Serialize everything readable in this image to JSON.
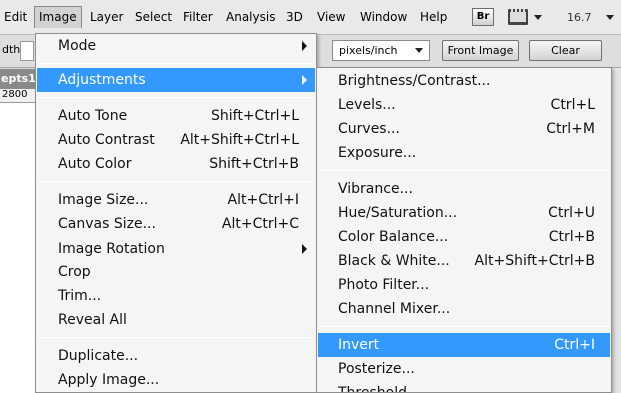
{
  "menubar": {
    "items": [
      "Edit",
      "Image",
      "Layer",
      "Select",
      "Filter",
      "Analysis",
      "3D",
      "View",
      "Window",
      "Help"
    ],
    "active": "Image",
    "bridge_label": "Br",
    "zoom": "16.7"
  },
  "options": {
    "width_label": "dth:",
    "units": "pixels/inch",
    "front_image": "Front Image",
    "clear": "Clear"
  },
  "document": {
    "tab": "epts1-",
    "ruler_value": "2800"
  },
  "image_menu": {
    "mode": "Mode",
    "adjustments": "Adjustments",
    "auto_tone": "Auto Tone",
    "auto_tone_sc": "Shift+Ctrl+L",
    "auto_contrast": "Auto Contrast",
    "auto_contrast_sc": "Alt+Shift+Ctrl+L",
    "auto_color": "Auto Color",
    "auto_color_sc": "Shift+Ctrl+B",
    "image_size": "Image Size...",
    "image_size_sc": "Alt+Ctrl+I",
    "canvas_size": "Canvas Size...",
    "canvas_size_sc": "Alt+Ctrl+C",
    "image_rotation": "Image Rotation",
    "crop": "Crop",
    "trim": "Trim...",
    "reveal_all": "Reveal All",
    "duplicate": "Duplicate...",
    "apply_image": "Apply Image..."
  },
  "adjustments_menu": {
    "brightness": "Brightness/Contrast...",
    "levels": "Levels...",
    "levels_sc": "Ctrl+L",
    "curves": "Curves...",
    "curves_sc": "Ctrl+M",
    "exposure": "Exposure...",
    "vibrance": "Vibrance...",
    "hue_sat": "Hue/Saturation...",
    "hue_sat_sc": "Ctrl+U",
    "color_balance": "Color Balance...",
    "color_balance_sc": "Ctrl+B",
    "black_white": "Black & White...",
    "black_white_sc": "Alt+Shift+Ctrl+B",
    "photo_filter": "Photo Filter...",
    "channel_mixer": "Channel Mixer...",
    "invert": "Invert",
    "invert_sc": "Ctrl+I",
    "posterize": "Posterize...",
    "threshold": "Threshold..."
  },
  "colors": {
    "highlight": "#3399ff",
    "menu_bg": "#f5f5f5"
  }
}
